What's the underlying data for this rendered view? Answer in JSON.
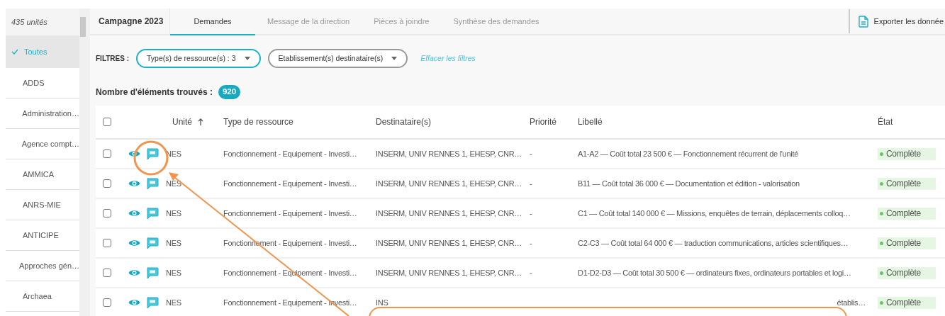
{
  "sidebar": {
    "count": "435 unités",
    "items": [
      {
        "label": "Toutes",
        "selected": true
      },
      {
        "label": "ADDS",
        "selected": false
      },
      {
        "label": "Administration…",
        "selected": false
      },
      {
        "label": "Agence compt…",
        "selected": false
      },
      {
        "label": "AMMICA",
        "selected": false
      },
      {
        "label": "ANRS-MIE",
        "selected": false
      },
      {
        "label": "ANTICIPE",
        "selected": false
      },
      {
        "label": "Approches gén…",
        "selected": false
      },
      {
        "label": "Archaea",
        "selected": false
      }
    ]
  },
  "header": {
    "title": "Campagne 2023",
    "tabs": [
      {
        "label": "Demandes",
        "selected": true
      },
      {
        "label": "Message de la direction",
        "selected": false
      },
      {
        "label": "Pièces à joindre",
        "selected": false
      },
      {
        "label": "Synthèse des demandes",
        "selected": false
      }
    ],
    "export": "Exporter les donnée"
  },
  "filters": {
    "label": "FILTRES :",
    "items": [
      {
        "label": "Type(s) de ressource(s) : 3",
        "active": true
      },
      {
        "label": "Etablissement(s) destinataire(s)",
        "active": false
      }
    ],
    "clear": "Effacer les filtres"
  },
  "count": {
    "label": "Nombre d'éléments trouvés :",
    "value": "920"
  },
  "table": {
    "select_all": {
      "checked": false
    },
    "columns": [
      "Unité",
      "Type de ressource",
      "Destinataire(s)",
      "Priorité",
      "Libellé",
      "État"
    ],
    "rows": [
      {
        "checked": false,
        "unit": "NES",
        "type": "Fonctionnement - Equipement - Investi…",
        "recipients": "INSERM, UNIV RENNES 1, EHESP, CNR…",
        "priority": "-",
        "label": "A1-A2 — Coût total 23 500 € — Fonctionnement récurrent de l'unité",
        "status": "Complète"
      },
      {
        "checked": false,
        "unit": "NES",
        "type": "Fonctionnement - Equipement - Investi…",
        "recipients": "INSERM, UNIV RENNES 1, EHESP, CNR…",
        "priority": "-",
        "label": "B11 — Coût total 36 000 € — Documentation et édition - valorisation",
        "status": "Complète"
      },
      {
        "checked": false,
        "unit": "NES",
        "type": "Fonctionnement - Equipement - Investi…",
        "recipients": "INSERM, UNIV RENNES 1, EHESP, CNR…",
        "priority": "-",
        "label": "C1 — Coût total 140 000 € — Missions, enquêtes de terrain, déplacements colloq…",
        "status": "Complète"
      },
      {
        "checked": false,
        "unit": "NES",
        "type": "Fonctionnement - Equipement - Investi…",
        "recipients": "INSERM, UNIV RENNES 1, EHESP, CNR…",
        "priority": "-",
        "label": "C2-C3 — Coût total 64 000 € — traduction communications, articles scientifiques…",
        "status": "Complète"
      },
      {
        "checked": false,
        "unit": "NES",
        "type": "Fonctionnement - Equipement - Investi…",
        "recipients": "INSERM, UNIV RENNES 1, EHESP, CNR…",
        "priority": "-",
        "label": "D1-D2-D3 — Coût total 30 500 € — ordinateurs fixes, ordinateurs portables et logi…",
        "status": "Complète"
      },
      {
        "checked": false,
        "unit": "NES",
        "type": "Fonctionnement - Equipement - Investi…",
        "recipients": "INS",
        "priority": "",
        "label": "établis…",
        "status": "Complète"
      }
    ]
  }
}
